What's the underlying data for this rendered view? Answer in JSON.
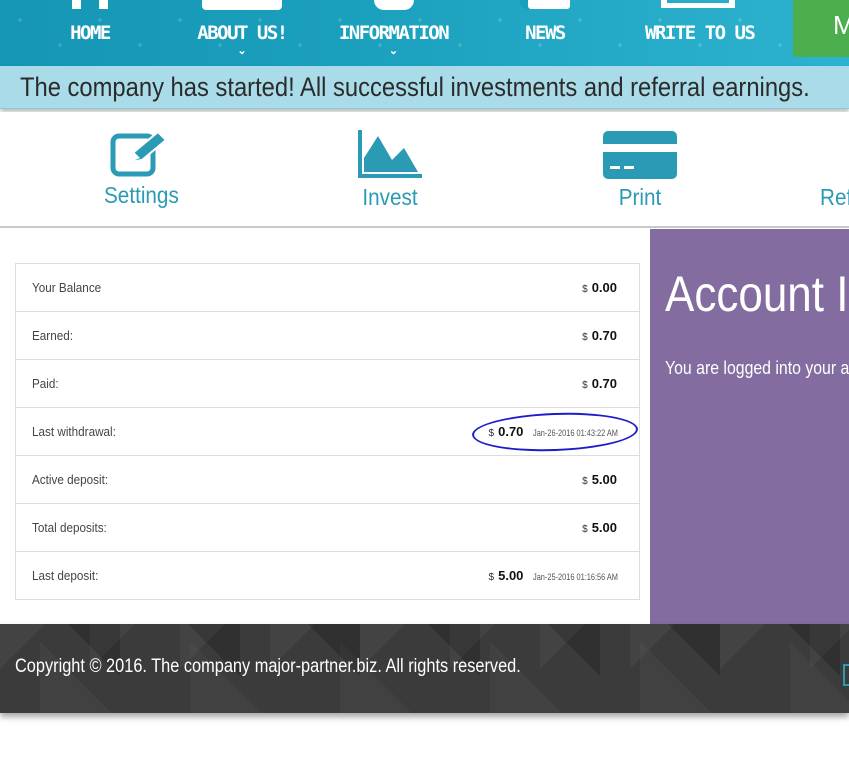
{
  "nav": {
    "items": [
      {
        "label": "home",
        "has_dropdown": false
      },
      {
        "label": "About us!",
        "has_dropdown": true
      },
      {
        "label": "Information",
        "has_dropdown": true
      },
      {
        "label": "News",
        "has_dropdown": false
      },
      {
        "label": "Write to us",
        "has_dropdown": false
      }
    ],
    "cta_label": "M"
  },
  "ticker": {
    "text": "The company has started! All successful investments and referral earnings."
  },
  "toolbar": {
    "items": [
      {
        "label": "Settings",
        "icon": "edit-icon"
      },
      {
        "label": "Invest",
        "icon": "area-chart-icon"
      },
      {
        "label": "Print",
        "icon": "credit-card-icon"
      },
      {
        "label": "Ref",
        "icon": "referral-icon"
      }
    ]
  },
  "stats": {
    "currency": "$",
    "rows": [
      {
        "label": "Your Balance",
        "amount": "0.00",
        "date": ""
      },
      {
        "label": "Earned:",
        "amount": "0.70",
        "date": ""
      },
      {
        "label": "Paid:",
        "amount": "0.70",
        "date": ""
      },
      {
        "label": "Last withdrawal:",
        "amount": "0.70",
        "date": "Jan-26-2016 01:43:22 AM"
      },
      {
        "label": "Active deposit:",
        "amount": "5.00",
        "date": ""
      },
      {
        "label": "Total deposits:",
        "amount": "5.00",
        "date": ""
      },
      {
        "label": "Last deposit:",
        "amount": "5.00",
        "date": "Jan-25-2016 01:16:56 AM"
      }
    ]
  },
  "account_panel": {
    "title": "Account Inf",
    "message": "You are logged into your acco"
  },
  "footer": {
    "copyright": "Copyright © 2016. The company major-partner.biz. All rights reserved."
  },
  "colors": {
    "nav_bg": "#1a9fbd",
    "ticker_bg": "#a9dce8",
    "accent": "#2a9ab5",
    "cta_green": "#4cae4c",
    "panel_purple": "#836ca0",
    "footer_bg": "#3b3b3b",
    "annotation_blue": "#1c1ccc"
  }
}
